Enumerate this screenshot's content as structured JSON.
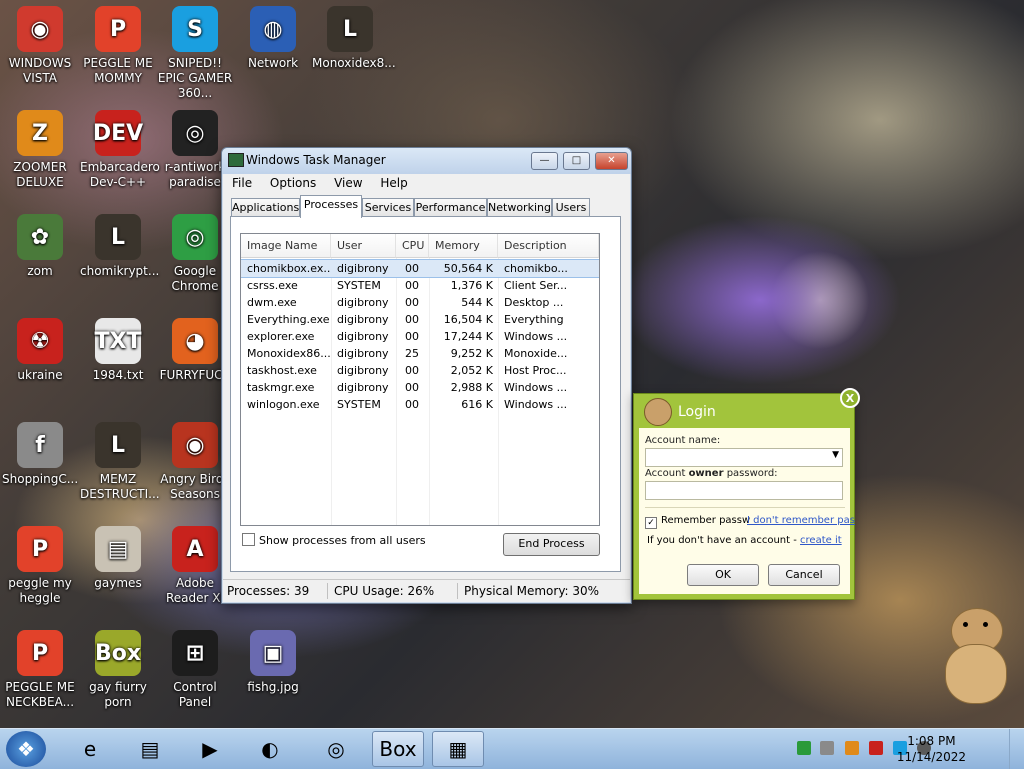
{
  "desktop_icons": [
    {
      "label": "WINDOWS VISTA",
      "icon": "vista-orb-icon",
      "color": "#d03a2e",
      "glyph": "◉"
    },
    {
      "label": "PEGGLE ME MOMMY",
      "icon": "peggle-icon",
      "color": "#e2422a",
      "glyph": "P"
    },
    {
      "label": "SNIPED!! EPIC GAMER 360...",
      "icon": "skype-icon",
      "color": "#1a9fe0",
      "glyph": "S"
    },
    {
      "label": "Network",
      "icon": "network-icon",
      "color": "#2b5fb5",
      "glyph": "◍"
    },
    {
      "label": "Monoxidex8...",
      "icon": "lock-file-icon",
      "color": "#3a342c",
      "glyph": "L"
    },
    {
      "label": "ZOOMER DELUXE",
      "icon": "zoomer-icon",
      "color": "#e08a1a",
      "glyph": "Z"
    },
    {
      "label": "Embarcadero Dev-C++",
      "icon": "devcpp-icon",
      "color": "#c8221d",
      "glyph": "DEV"
    },
    {
      "label": "r-antiwork paradise",
      "icon": "antiwork-icon",
      "color": "#222222",
      "glyph": "◎"
    },
    {
      "label": "zom",
      "icon": "flower-icon",
      "color": "#4a7a3a",
      "glyph": "✿"
    },
    {
      "label": "chomikrypt...",
      "icon": "lock-file-icon",
      "color": "#3a342c",
      "glyph": "L"
    },
    {
      "label": "Google Chrome",
      "icon": "chrome-icon",
      "color": "#2e9e44",
      "glyph": "◎"
    },
    {
      "label": "ukraine",
      "icon": "radiation-icon",
      "color": "#c8221d",
      "glyph": "☢"
    },
    {
      "label": "1984.txt",
      "icon": "text-file-icon",
      "color": "#e8e8e8",
      "glyph": "TXT"
    },
    {
      "label": "FURRYFUCK",
      "icon": "firefox-icon",
      "color": "#e2621e",
      "glyph": "◕"
    },
    {
      "label": "ShoppingC...",
      "icon": "flash-icon",
      "color": "#8a8a8a",
      "glyph": "f"
    },
    {
      "label": "MEMZ DESTRUCTI...",
      "icon": "lock-file-icon",
      "color": "#3a342c",
      "glyph": "L"
    },
    {
      "label": "Angry Birds Seasons",
      "icon": "angry-birds-icon",
      "color": "#b8341f",
      "glyph": "◉"
    },
    {
      "label": "peggle my heggle",
      "icon": "peggle-icon",
      "color": "#e2422a",
      "glyph": "P"
    },
    {
      "label": "gaymes",
      "icon": "folder-icon",
      "color": "#c9c2b4",
      "glyph": "▤"
    },
    {
      "label": "Adobe Reader XI",
      "icon": "adobe-reader-icon",
      "color": "#c8221d",
      "glyph": "A"
    },
    {
      "label": "PEGGLE ME NECKBEA...",
      "icon": "peggle-icon",
      "color": "#e2422a",
      "glyph": "P"
    },
    {
      "label": "gay fiurry porn",
      "icon": "box-hamster-icon",
      "color": "#9aa82a",
      "glyph": "Box"
    },
    {
      "label": "Control Panel",
      "icon": "control-panel-icon",
      "color": "#1d1d1d",
      "glyph": "⊞"
    },
    {
      "label": "fishg.jpg",
      "icon": "image-file-icon",
      "color": "#6a6ab0",
      "glyph": "▣"
    }
  ],
  "taskmgr": {
    "title": "Windows Task Manager",
    "buttons": {
      "minimize": "—",
      "maximize": "□",
      "close": "✕"
    },
    "menu": [
      "File",
      "Options",
      "View",
      "Help"
    ],
    "tabs": [
      "Applications",
      "Processes",
      "Services",
      "Performance",
      "Networking",
      "Users"
    ],
    "active_tab": "Processes",
    "columns": [
      "Image Name",
      "User Name",
      "CPU",
      "Memory (...",
      "Description"
    ],
    "processes": [
      {
        "name": "chomikbox.ex...",
        "user": "digibrony",
        "cpu": "00",
        "mem": "50,564 K",
        "desc": "chomikbo..."
      },
      {
        "name": "csrss.exe",
        "user": "SYSTEM",
        "cpu": "00",
        "mem": "1,376 K",
        "desc": "Client Ser..."
      },
      {
        "name": "dwm.exe",
        "user": "digibrony",
        "cpu": "00",
        "mem": "544 K",
        "desc": "Desktop ..."
      },
      {
        "name": "Everything.exe",
        "user": "digibrony",
        "cpu": "00",
        "mem": "16,504 K",
        "desc": "Everything"
      },
      {
        "name": "explorer.exe",
        "user": "digibrony",
        "cpu": "00",
        "mem": "17,244 K",
        "desc": "Windows ..."
      },
      {
        "name": "Monoxidex86....",
        "user": "digibrony",
        "cpu": "25",
        "mem": "9,252 K",
        "desc": "Monoxide..."
      },
      {
        "name": "taskhost.exe",
        "user": "digibrony",
        "cpu": "00",
        "mem": "2,052 K",
        "desc": "Host Proc..."
      },
      {
        "name": "taskmgr.exe",
        "user": "digibrony",
        "cpu": "00",
        "mem": "2,988 K",
        "desc": "Windows ..."
      },
      {
        "name": "winlogon.exe",
        "user": "SYSTEM",
        "cpu": "00",
        "mem": "616 K",
        "desc": "Windows ..."
      }
    ],
    "show_all_label": "Show processes from all users",
    "end_process_label": "End Process",
    "status": {
      "processes": "Processes: 39",
      "cpu": "CPU Usage: 26%",
      "memory": "Physical Memory: 30%"
    }
  },
  "login": {
    "title": "Login",
    "close": "X",
    "account_name_label": "Account name:",
    "password_label_pre": "Account ",
    "password_label_bold": "owner",
    "password_label_post": " password:",
    "remember_label": "Remember passw",
    "forgot_link": "I don't remember pas",
    "no_account_text": "If you don't have an account - ",
    "create_link": "create it",
    "ok_label": "OK",
    "cancel_label": "Cancel",
    "accent": "#a2c43c"
  },
  "taskbar": {
    "pinned": [
      {
        "icon": "start-orb-icon",
        "glyph": "❖"
      },
      {
        "icon": "internet-explorer-icon",
        "glyph": "e"
      },
      {
        "icon": "explorer-folder-icon",
        "glyph": "▤"
      },
      {
        "icon": "media-player-icon",
        "glyph": "▶"
      },
      {
        "icon": "uc-browser-icon",
        "glyph": "◐"
      },
      {
        "icon": "chrome-taskbar-icon",
        "glyph": "◎"
      },
      {
        "icon": "chomikbox-taskbar-icon",
        "glyph": "Box"
      },
      {
        "icon": "taskmgr-taskbar-icon",
        "glyph": "▦"
      }
    ],
    "time": "1:08 PM",
    "date": "11/14/2022"
  }
}
